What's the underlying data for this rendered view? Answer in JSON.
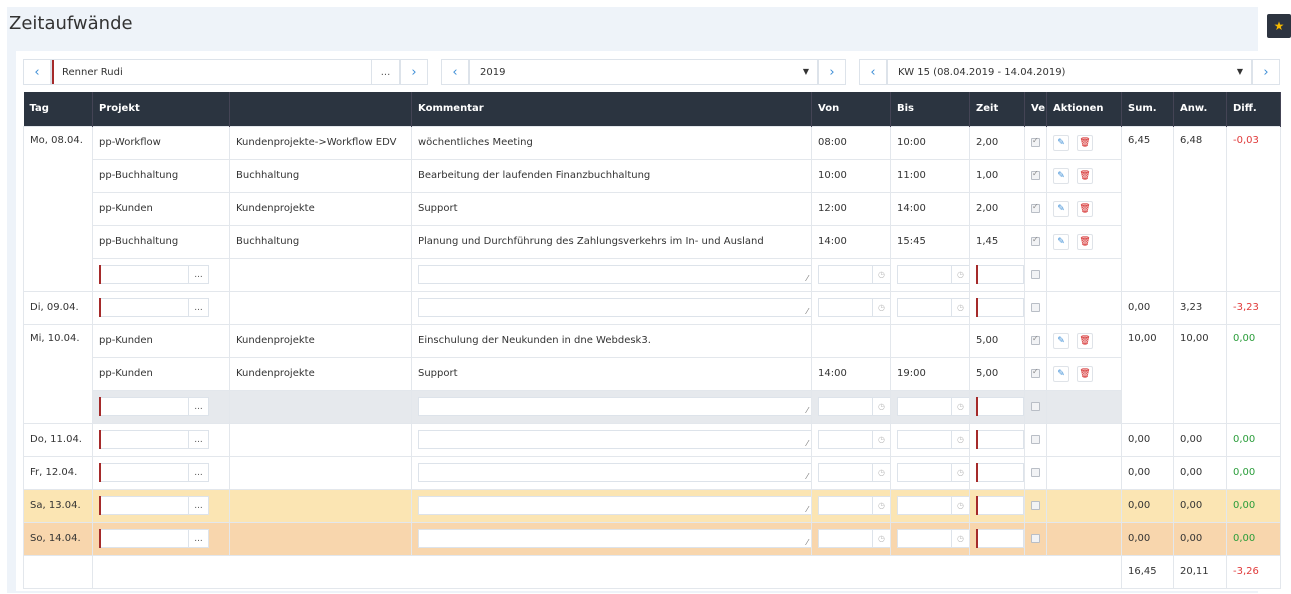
{
  "page": {
    "title": "Zeitaufwände"
  },
  "filters": {
    "employee": {
      "value": "Renner Rudi",
      "dots": "..."
    },
    "year": {
      "value": "2019"
    },
    "week": {
      "value": "KW 15 (08.04.2019 - 14.04.2019)"
    }
  },
  "icons": {
    "prev": "‹",
    "next": "›",
    "caret": "▼",
    "star": "★",
    "edit": "✎",
    "delete": "🗑",
    "clock": "◷",
    "dots": "..."
  },
  "columns": [
    "Tag",
    "Projekt",
    "",
    "Kommentar",
    "Von",
    "Bis",
    "Zeit",
    "Ve",
    "Aktionen",
    "Sum.",
    "Anw.",
    "Diff."
  ],
  "days": [
    {
      "day": "Mo, 08.04.",
      "sum": "6,45",
      "anw": "6,48",
      "diff": "-0,03",
      "diff_sign": "neg",
      "style": "",
      "entries": [
        {
          "projekt": "pp-Workflow",
          "kategorie": "Kundenprojekte->Workflow EDV",
          "kommentar": "wöchentliches Meeting",
          "von": "08:00",
          "bis": "10:00",
          "zeit": "2,00"
        },
        {
          "projekt": "pp-Buchhaltung",
          "kategorie": "Buchhaltung",
          "kommentar": "Bearbeitung der laufenden Finanzbuchhaltung",
          "von": "10:00",
          "bis": "11:00",
          "zeit": "1,00"
        },
        {
          "projekt": "pp-Kunden",
          "kategorie": "Kundenprojekte",
          "kommentar": "Support",
          "von": "12:00",
          "bis": "14:00",
          "zeit": "2,00"
        },
        {
          "projekt": "pp-Buchhaltung",
          "kategorie": "Buchhaltung",
          "kommentar": "Planung und Durchführung des Zahlungsverkehrs im In- und Ausland",
          "von": "14:00",
          "bis": "15:45",
          "zeit": "1,45"
        }
      ]
    },
    {
      "day": "Di, 09.04.",
      "sum": "0,00",
      "anw": "3,23",
      "diff": "-3,23",
      "diff_sign": "neg",
      "style": "",
      "entries": []
    },
    {
      "day": "Mi, 10.04.",
      "sum": "10,00",
      "anw": "10,00",
      "diff": "0,00",
      "diff_sign": "pos",
      "style": "",
      "new_row_style": "gray",
      "entries": [
        {
          "projekt": "pp-Kunden",
          "kategorie": "Kundenprojekte",
          "kommentar": "Einschulung der Neukunden in dne Webdesk3.",
          "von": "",
          "bis": "",
          "zeit": "5,00"
        },
        {
          "projekt": "pp-Kunden",
          "kategorie": "Kundenprojekte",
          "kommentar": "Support",
          "von": "14:00",
          "bis": "19:00",
          "zeit": "5,00"
        }
      ]
    },
    {
      "day": "Do, 11.04.",
      "sum": "0,00",
      "anw": "0,00",
      "diff": "0,00",
      "diff_sign": "pos",
      "style": "",
      "entries": []
    },
    {
      "day": "Fr, 12.04.",
      "sum": "0,00",
      "anw": "0,00",
      "diff": "0,00",
      "diff_sign": "pos",
      "style": "",
      "entries": []
    },
    {
      "day": "Sa, 13.04.",
      "sum": "0,00",
      "anw": "0,00",
      "diff": "0,00",
      "diff_sign": "pos",
      "style": "sat",
      "entries": []
    },
    {
      "day": "So, 14.04.",
      "sum": "0,00",
      "anw": "0,00",
      "diff": "0,00",
      "diff_sign": "pos",
      "style": "sun",
      "entries": []
    }
  ],
  "totals": {
    "sum": "16,45",
    "anw": "20,11",
    "diff": "-3,26",
    "diff_sign": "neg"
  },
  "colors": {
    "header_bg": "#2b3440",
    "saturday": "#fbe5b3",
    "sunday": "#f8d6ad",
    "negative": "#e03a3a",
    "positive": "#2a9d3a",
    "accent": "#3b8dd6"
  }
}
